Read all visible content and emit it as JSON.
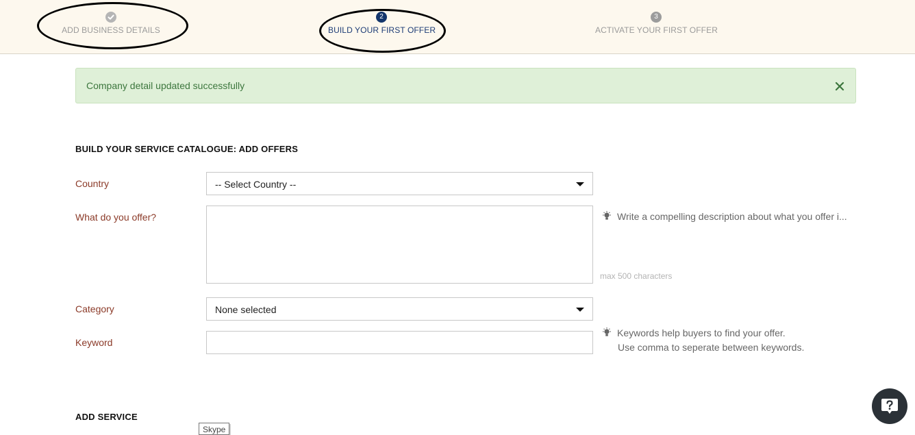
{
  "stepper": {
    "steps": [
      {
        "label": "ADD BUSINESS DETAILS",
        "state": "complete",
        "icon": "check-icon"
      },
      {
        "number": "2",
        "label": "BUILD YOUR FIRST OFFER",
        "state": "current"
      },
      {
        "number": "3",
        "label": "ACTIVATE YOUR FIRST OFFER",
        "state": "pending"
      }
    ]
  },
  "alert": {
    "message": "Company detail updated successfully",
    "close_icon": "close-icon"
  },
  "form": {
    "title": "BUILD YOUR SERVICE CATALOGUE: ADD OFFERS",
    "country": {
      "label": "Country",
      "value": "-- Select Country --"
    },
    "offer": {
      "label": "What do you offer?",
      "value": "",
      "hint": "Write a compelling description about what you offer i...",
      "max_note": "max 500 characters"
    },
    "category": {
      "label": "Category",
      "value": "None selected"
    },
    "keyword": {
      "label": "Keyword",
      "value": "",
      "hint_line1": "Keywords help buyers to find your offer.",
      "hint_line2": "Use comma to seperate between keywords."
    },
    "service_title": "ADD SERVICE"
  },
  "tooltip": {
    "text": "Skype"
  },
  "help_button": {
    "icon": "help-question-icon"
  },
  "colors": {
    "stepper_bg": "#fdf8ee",
    "current_step": "#13356b",
    "alert_bg": "#dff0d8",
    "alert_text": "#3c763d",
    "label_text": "#8b3a28"
  }
}
